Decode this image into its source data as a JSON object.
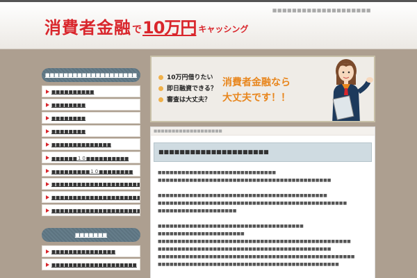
{
  "site": {
    "tagline": "■■■■■■■■■■■■■■■■■■■■",
    "logo": {
      "part1": "消費者金融",
      "part2": "で",
      "part3": "10万円",
      "part4": "キャッシング"
    }
  },
  "sidebar": {
    "section1": {
      "title": "■■■■■■■■■■■■■■■■■■■■",
      "items": [
        {
          "label": "■■■■■■■■■■"
        },
        {
          "label": "■■■■■■■■"
        },
        {
          "label": "■■■■■■■■"
        },
        {
          "label": "■■■■■■■■"
        },
        {
          "label": "■■■■■■■■■■■■■■"
        },
        {
          "label": "■■■■■■１０■■■■■■■■■■"
        },
        {
          "label": "■■■■■■■■■１０■■■■■■■■"
        },
        {
          "label": "■■■■■■■■■■■■■■■■■■■■■■■■■■"
        },
        {
          "label": "■■■■■■■■■■■■■■■■■■■■■■■"
        },
        {
          "label": "■■■■■■■■■■■■■■■■■■■■■■■■■"
        }
      ]
    },
    "section2": {
      "title": "■■■■■■■",
      "items": [
        {
          "label": "■■■■■■■■■■■■■■■"
        },
        {
          "label": "■■■■■■■■■■■■■■■■■■■■"
        }
      ]
    }
  },
  "banner": {
    "questions": [
      "10万円借りたい",
      "即日融資できる？",
      "審査は大丈夫？"
    ],
    "headline1": "消費者金融なら",
    "headline2": "大丈夫です！！"
  },
  "main": {
    "breadcrumb": "■■■■■■■■■■■■■■■■■■■",
    "title": "■■■■■■■■■■■■■■■■■■■■■",
    "paragraphs": [
      [
        "■■■■■■■■■■■■■■■■■■■■■■■■■■■■■■",
        "■■■■■■■■■■■■■■■■■■■■■■■■■■■■■■■■■■■■■■■■■■■■"
      ],
      [
        "■■■■■■■■■■■■■■■■■■■■■■■■■■■■■■■■■■■■■■■■■■■",
        "■■■■■■■■■■■■■■■■■■■■■■■■■■■■■■■■■■■■■■■■■■■■■■■■",
        "■■■■■■■■■■■■■■■■■■■■"
      ],
      [
        "■■■■■■■■■■■■■■■■■■■■■■■■■■■■■■■■■■■■■",
        "■■■■■■■■■■■■■■■■■■■■■■",
        "■■■■■■■■■■■■■■■■■■■■■■■■■■■■■■■■■■■■■■■■■■■■■■■■■",
        "■■■■■■■■■■■■■■■■■■■■■■■■■■■■■■■■■■■■■■■■■■■■",
        "■■■■■■■■■■■■■■■■■■■■■■■■■■■■■■■■■■■■■■■■■■■■■■■■■■",
        "■■■■■■■■■■■■■■■■■■■■■■■■■■■■■■■■■■■■■■■■■■■■■■"
      ]
    ]
  },
  "colors": {
    "accent_red": "#d9262c",
    "banner_orange": "#e8861d",
    "page_bg": "#ad9f90",
    "sidebar_title_bg": "#5c7380",
    "title_bg": "#cfdbe1"
  }
}
